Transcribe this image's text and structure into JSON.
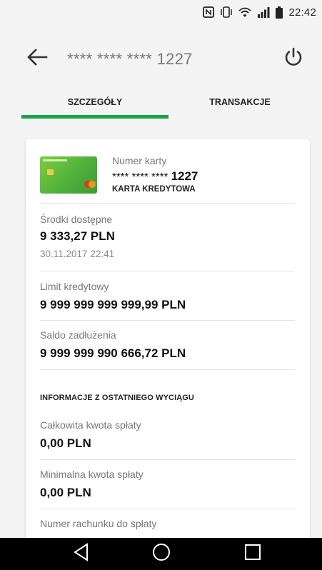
{
  "status_bar": {
    "time": "22:42",
    "icons": [
      "nfc-icon",
      "vibrate-icon",
      "wifi-icon",
      "signal-icon",
      "battery-icon"
    ]
  },
  "app_bar": {
    "title": "**** **** **** 1227",
    "back_icon": "arrow-back-icon",
    "power_icon": "power-icon"
  },
  "tabs": [
    {
      "label": "SZCZEGÓŁY",
      "active": true
    },
    {
      "label": "TRANSAKCJE",
      "active": false
    }
  ],
  "colors": {
    "accent": "#1aa34a",
    "background": "#f4f4f4",
    "panel": "#ffffff"
  },
  "card": {
    "number_label": "Numer karty",
    "number_masked": "**** **** ****",
    "number_last4": "1227",
    "type": "KARTA KREDYTOWA"
  },
  "details": {
    "available_funds": {
      "label": "Środki dostępne",
      "value": "9 333,27 PLN",
      "date": "30.11.2017 22:41"
    },
    "credit_limit": {
      "label": "Limit kredytowy",
      "value": "9 999 999 999 999,99 PLN"
    },
    "debt_balance": {
      "label": "Saldo zadłużenia",
      "value": "9 999 999 990 666,72 PLN"
    }
  },
  "statement": {
    "heading": "INFORMACJE Z OSTATNIEGO WYCIĄGU",
    "total_repayment": {
      "label": "Całkowita kwota spłaty",
      "value": "0,00 PLN"
    },
    "minimum_repayment": {
      "label": "Minimalna kwota spłaty",
      "value": "0,00 PLN"
    },
    "repayment_account": {
      "label": "Numer rachunku do spłaty"
    }
  },
  "nav_bar": {
    "buttons": [
      "nav-back-icon",
      "nav-home-icon",
      "nav-recents-icon"
    ]
  }
}
